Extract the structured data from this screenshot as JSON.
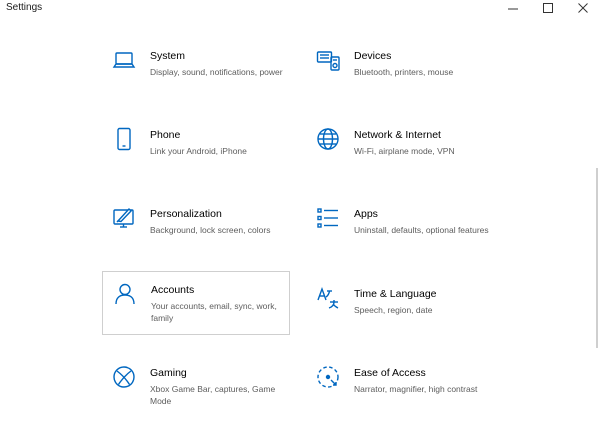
{
  "window": {
    "title": "Settings"
  },
  "colors": {
    "accent": "#0067c0",
    "text": "#000000",
    "secondary_text": "#5d5d5d",
    "selection_border": "#cfcfcf"
  },
  "tiles": [
    {
      "name": "System",
      "description": "Display, sound, notifications, power",
      "icon": "laptop-icon"
    },
    {
      "name": "Devices",
      "description": "Bluetooth, printers, mouse",
      "icon": "devices-icon"
    },
    {
      "name": "Phone",
      "description": "Link your Android, iPhone",
      "icon": "phone-icon"
    },
    {
      "name": "Network & Internet",
      "description": "Wi-Fi, airplane mode, VPN",
      "icon": "globe-icon"
    },
    {
      "name": "Personalization",
      "description": "Background, lock screen, colors",
      "icon": "personalization-icon"
    },
    {
      "name": "Apps",
      "description": "Uninstall, defaults, optional features",
      "icon": "apps-list-icon"
    },
    {
      "name": "Accounts",
      "description": "Your accounts, email, sync, work, family",
      "icon": "person-icon"
    },
    {
      "name": "Time & Language",
      "description": "Speech, region, date",
      "icon": "time-language-icon"
    },
    {
      "name": "Gaming",
      "description": "Xbox Game Bar, captures, Game Mode",
      "icon": "xbox-icon"
    },
    {
      "name": "Ease of Access",
      "description": "Narrator, magnifier, high contrast",
      "icon": "ease-of-access-icon"
    }
  ]
}
